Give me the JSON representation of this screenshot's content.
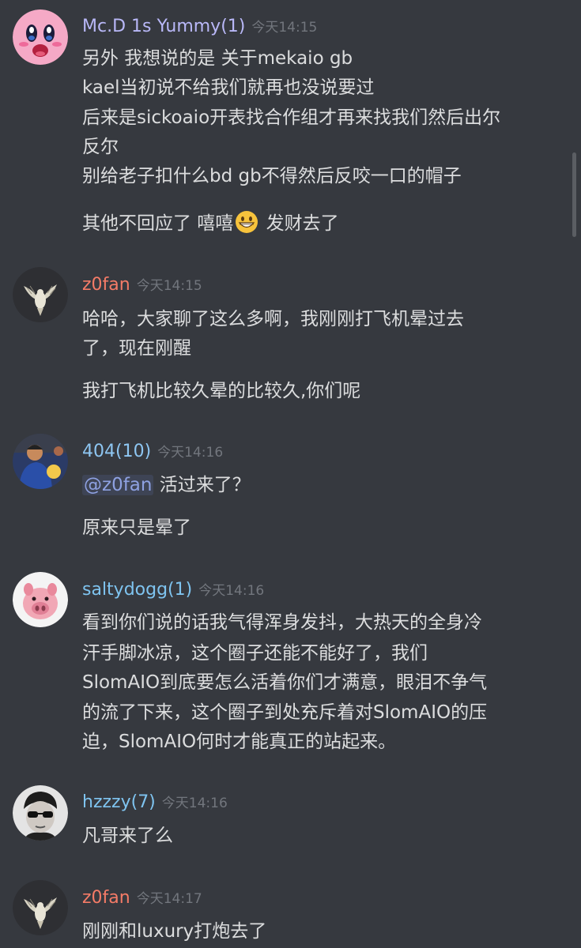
{
  "colors": {
    "background": "#36393f",
    "text": "#dcddde",
    "timestamp": "#72767d",
    "mention_text": "#8ea1e1",
    "user_mcd": "#b9b8f8",
    "user_z0fan": "#f47b67",
    "user_404": "#8ec6f2",
    "user_salty": "#7fc4f0",
    "user_hzzzy": "#7fc4f0"
  },
  "messages": [
    {
      "username": "Mc.D 1s Yummy(1)",
      "timestamp": "今天14:15",
      "avatar_icon": "kirby-avatar-icon",
      "lines": [
        "另外 我想说的是 关于mekaio gb",
        "kael当初说不给我们就再也没说要过",
        "后来是sickoaio开表找合作组才再来找我们然后出尔",
        "反尔",
        "别给老子扣什么bd gb不得然后反咬一口的帽子"
      ],
      "last_line_before": "其他不回应了 嘻嘻",
      "last_line_emoji": "grinning-emoji-icon",
      "last_line_after": " 发财去了"
    },
    {
      "username": "z0fan",
      "timestamp": "今天14:15",
      "avatar_icon": "dove-avatar-icon",
      "lines": [
        "哈哈，大家聊了这么多啊，我刚刚打飞机晕过去",
        "了，现在刚醒",
        "我打飞机比较久晕的比较久,你们呢"
      ]
    },
    {
      "username": "404(10)",
      "timestamp": "今天14:16",
      "avatar_icon": "kid-photo-avatar-icon",
      "mention": "@z0fan",
      "mention_after": " 活过来了？",
      "lines": [
        "原来只是晕了"
      ]
    },
    {
      "username": "saltydogg(1)",
      "timestamp": "今天14:16",
      "avatar_icon": "pig-avatar-icon",
      "lines": [
        "看到你们说的话我气得浑身发抖，大热天的全身冷",
        "汗手脚冰凉，这个圈子还能不能好了，我们",
        "SlomAIO到底要怎么活着你们才满意，眼泪不争气",
        "的流了下来，这个圈子到处充斥着对SlomAIO的压",
        "迫，SlomAIO何时才能真正的站起来。"
      ]
    },
    {
      "username": "hzzzy(7)",
      "timestamp": "今天14:16",
      "avatar_icon": "sunglasses-person-avatar-icon",
      "lines": [
        "凡哥来了么"
      ]
    },
    {
      "username": "z0fan",
      "timestamp": "今天14:17",
      "avatar_icon": "dove-avatar-icon",
      "lines": [
        "刚刚和luxury打炮去了"
      ]
    }
  ]
}
